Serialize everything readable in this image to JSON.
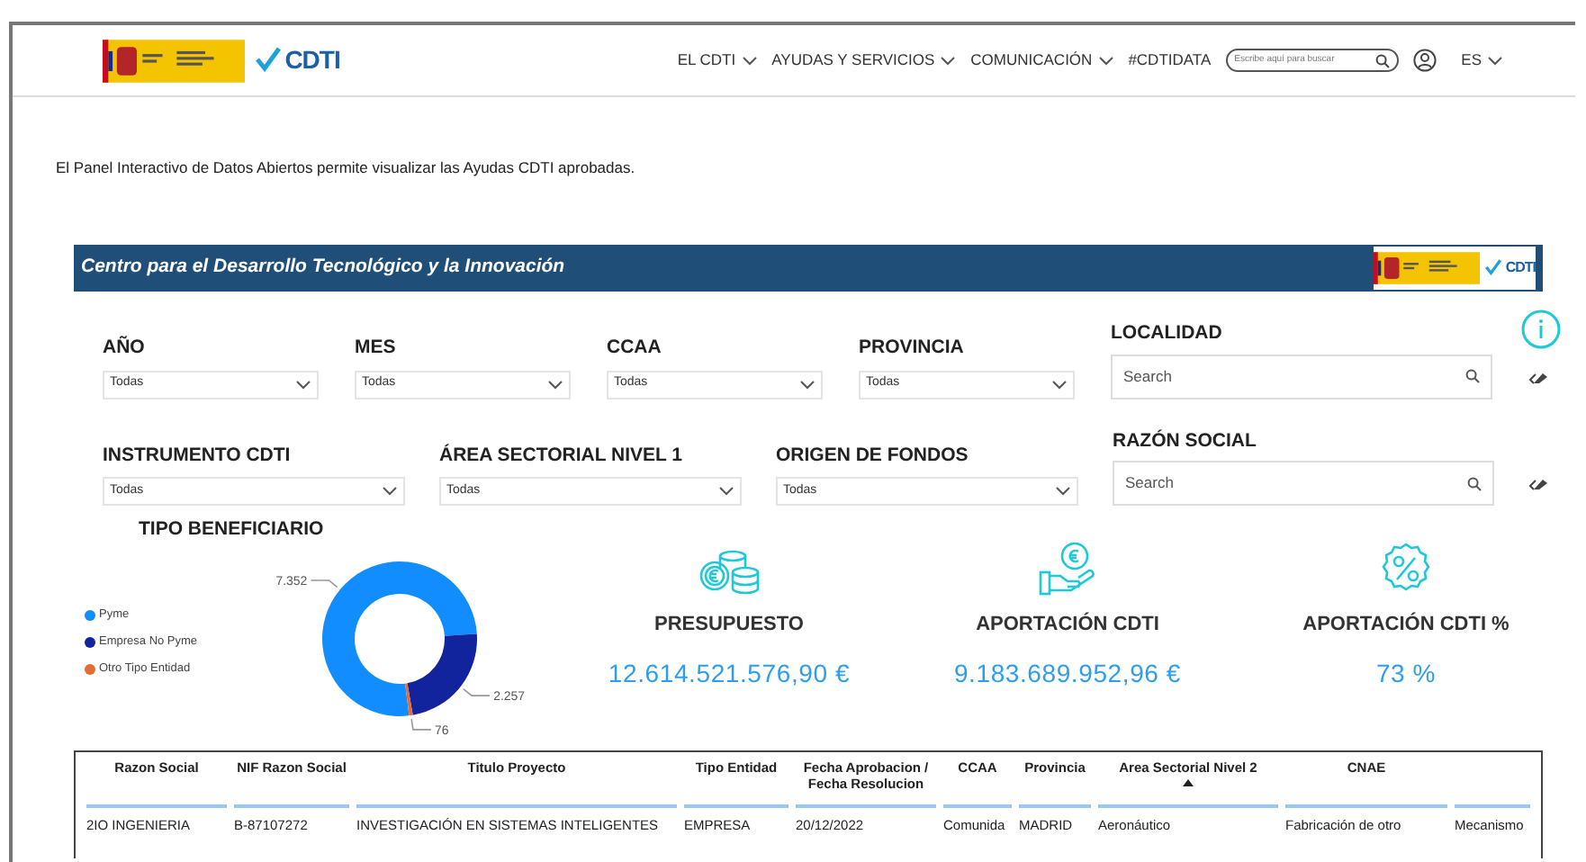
{
  "header": {
    "nav": [
      {
        "label": "EL CDTI",
        "dropdown": true
      },
      {
        "label": "AYUDAS Y SERVICIOS",
        "dropdown": true
      },
      {
        "label": "COMUNICACIÓN",
        "dropdown": true
      },
      {
        "label": "#CDTIDATA",
        "dropdown": false
      }
    ],
    "search": {
      "placeholder": "Escribe aquí para buscar"
    },
    "language": "ES",
    "logo_text": "CDTI"
  },
  "intro": "El Panel Interactivo de Datos Abiertos permite visualizar las Ayudas CDTI aprobadas.",
  "banner": {
    "title": "Centro para el Desarrollo Tecnológico y la Innovación",
    "logo_text": "CDTI"
  },
  "filter_rows": [
    [
      {
        "kind": "dropdown",
        "label": "AÑO",
        "value": "Todas"
      },
      {
        "kind": "dropdown",
        "label": "MES",
        "value": "Todas"
      },
      {
        "kind": "dropdown",
        "label": "CCAA",
        "value": "Todas"
      },
      {
        "kind": "dropdown",
        "label": "PROVINCIA",
        "value": "Todas"
      },
      {
        "kind": "search",
        "label": "LOCALIDAD",
        "placeholder": "Search"
      }
    ],
    [
      {
        "kind": "dropdown",
        "label": "INSTRUMENTO CDTI",
        "value": "Todas"
      },
      {
        "kind": "dropdown",
        "label": "ÁREA SECTORIAL NIVEL 1",
        "value": "Todas"
      },
      {
        "kind": "dropdown",
        "label": "ORIGEN DE FONDOS",
        "value": "Todas"
      },
      {
        "kind": "search",
        "label": "RAZÓN SOCIAL",
        "placeholder": "Search"
      }
    ]
  ],
  "beneficiary": {
    "title": "TIPO BENEFICIARIO",
    "legend": [
      {
        "color": "#118dff"
      },
      {
        "color": "#12239e"
      },
      {
        "color": "#e66c37"
      }
    ],
    "chart_data": {
      "type": "donut",
      "categories": [
        "Pyme",
        "Empresa No Pyme",
        "Otro Tipo Entidad"
      ],
      "values": [
        7352,
        2257,
        76
      ],
      "value_labels": [
        "7.352",
        "2.257",
        "76"
      ]
    }
  },
  "kpis": [
    {
      "kind": "coins",
      "label": "PRESUPUESTO",
      "value": "12.614.521.576,90 €"
    },
    {
      "kind": "hand",
      "label": "APORTACIÓN CDTI",
      "value": "9.183.689.952,96 €"
    },
    {
      "kind": "percent",
      "label": "APORTACIÓN CDTI %",
      "value": "73 %"
    }
  ],
  "table": {
    "columns": [
      {
        "label": "Razon Social",
        "sorted": false
      },
      {
        "label": "NIF Razon Social",
        "sorted": false
      },
      {
        "label": "Titulo Proyecto",
        "sorted": false
      },
      {
        "label": "Tipo Entidad",
        "sorted": false
      },
      {
        "label": "Fecha Aprobacion / Fecha Resolucion",
        "sorted": false
      },
      {
        "label": "CCAA",
        "sorted": false
      },
      {
        "label": "Provincia",
        "sorted": false
      },
      {
        "label": "Area Sectorial Nivel 2",
        "sorted": true
      },
      {
        "label": "CNAE",
        "sorted": false
      },
      {
        "sorted": false
      }
    ],
    "rows": [
      [
        "2IO INGENIERIA",
        "B-87107272",
        "INVESTIGACIÓN EN SISTEMAS INTELIGENTES",
        "EMPRESA",
        "20/12/2022",
        "Comunida",
        "MADRID",
        "Aeronáutico",
        "Fabricación de otro",
        "Mecanismo"
      ]
    ]
  }
}
